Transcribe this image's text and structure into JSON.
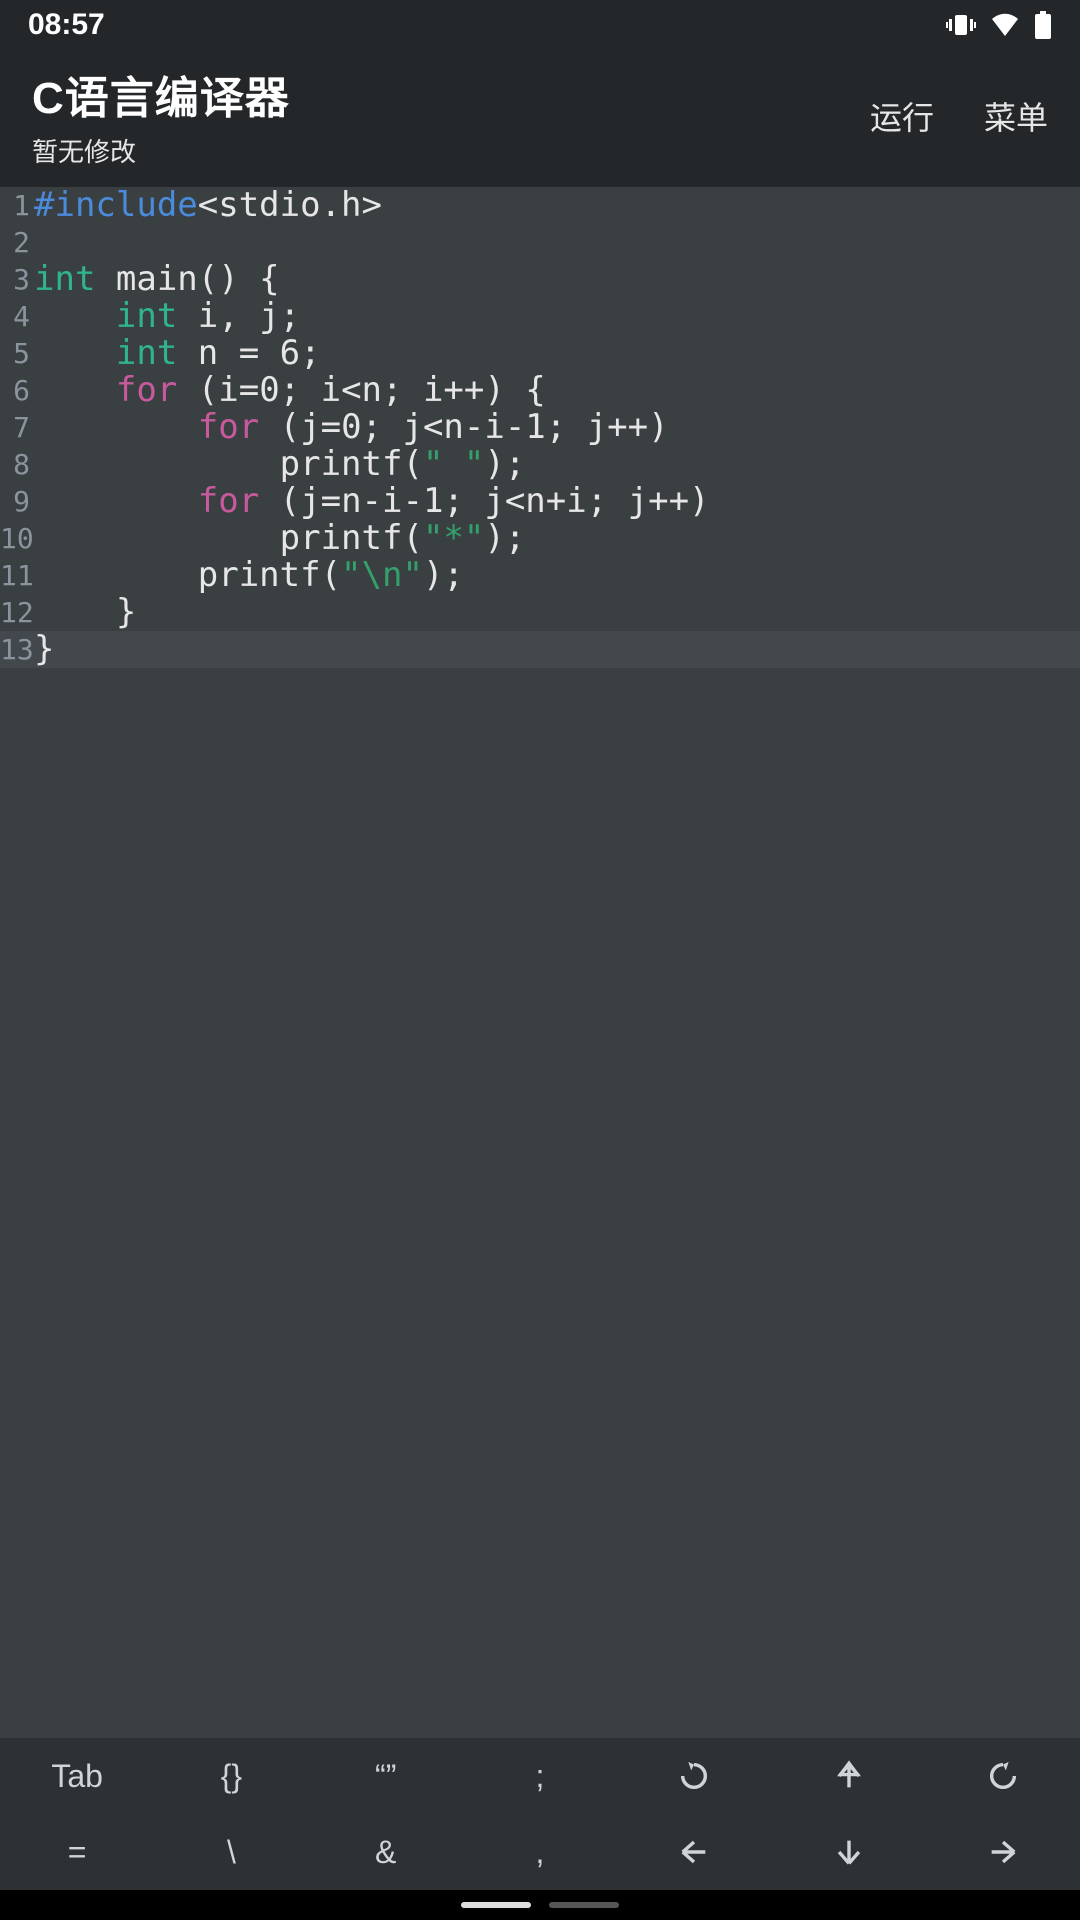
{
  "status": {
    "time": "08:57"
  },
  "header": {
    "title": "C语言编译器",
    "subtitle": "暂无修改",
    "run_label": "运行",
    "menu_label": "菜单"
  },
  "code": {
    "current_line_index": 12,
    "lines": [
      {
        "n": "1",
        "tokens": [
          {
            "c": "pre",
            "t": "#include"
          },
          {
            "c": "plain",
            "t": "<stdio.h>"
          }
        ]
      },
      {
        "n": "2",
        "tokens": [
          {
            "c": "plain",
            "t": ""
          }
        ]
      },
      {
        "n": "3",
        "tokens": [
          {
            "c": "kw",
            "t": "int"
          },
          {
            "c": "plain",
            "t": " main() {"
          }
        ]
      },
      {
        "n": "4",
        "tokens": [
          {
            "c": "plain",
            "t": "    "
          },
          {
            "c": "kw",
            "t": "int"
          },
          {
            "c": "plain",
            "t": " i, j;"
          }
        ]
      },
      {
        "n": "5",
        "tokens": [
          {
            "c": "plain",
            "t": "    "
          },
          {
            "c": "kw",
            "t": "int"
          },
          {
            "c": "plain",
            "t": " n = 6;"
          }
        ]
      },
      {
        "n": "6",
        "tokens": [
          {
            "c": "plain",
            "t": "    "
          },
          {
            "c": "ctrl",
            "t": "for"
          },
          {
            "c": "plain",
            "t": " (i=0; i<n; i++) {"
          }
        ]
      },
      {
        "n": "7",
        "tokens": [
          {
            "c": "plain",
            "t": "        "
          },
          {
            "c": "ctrl",
            "t": "for"
          },
          {
            "c": "plain",
            "t": " (j=0; j<n-i-1; j++)"
          }
        ]
      },
      {
        "n": "8",
        "tokens": [
          {
            "c": "plain",
            "t": "            printf("
          },
          {
            "c": "str",
            "t": "\" \""
          },
          {
            "c": "plain",
            "t": ");"
          }
        ]
      },
      {
        "n": "9",
        "tokens": [
          {
            "c": "plain",
            "t": "        "
          },
          {
            "c": "ctrl",
            "t": "for"
          },
          {
            "c": "plain",
            "t": " (j=n-i-1; j<n+i; j++)"
          }
        ]
      },
      {
        "n": "10",
        "tokens": [
          {
            "c": "plain",
            "t": "            printf("
          },
          {
            "c": "str",
            "t": "\"*\""
          },
          {
            "c": "plain",
            "t": ");"
          }
        ]
      },
      {
        "n": "11",
        "tokens": [
          {
            "c": "plain",
            "t": "        printf("
          },
          {
            "c": "str",
            "t": "\"\\n\""
          },
          {
            "c": "plain",
            "t": ");"
          }
        ]
      },
      {
        "n": "12",
        "tokens": [
          {
            "c": "plain",
            "t": "    }"
          }
        ]
      },
      {
        "n": "13",
        "tokens": [
          {
            "c": "plain",
            "t": "}"
          }
        ]
      }
    ]
  },
  "toolbar": {
    "row1": [
      {
        "kind": "text",
        "label": "Tab",
        "name": "key-tab"
      },
      {
        "kind": "text",
        "label": "{}",
        "name": "key-braces"
      },
      {
        "kind": "text",
        "label": "“”",
        "name": "key-quotes"
      },
      {
        "kind": "text",
        "label": ";",
        "name": "key-semicolon"
      },
      {
        "kind": "icon",
        "icon": "undo",
        "name": "key-undo"
      },
      {
        "kind": "icon",
        "icon": "arrow-up",
        "name": "key-arrow-up"
      },
      {
        "kind": "icon",
        "icon": "redo",
        "name": "key-redo"
      }
    ],
    "row2": [
      {
        "kind": "text",
        "label": "=",
        "name": "key-equals"
      },
      {
        "kind": "text",
        "label": "\\",
        "name": "key-backslash"
      },
      {
        "kind": "text",
        "label": "&",
        "name": "key-ampersand"
      },
      {
        "kind": "text",
        "label": ",",
        "name": "key-comma"
      },
      {
        "kind": "icon",
        "icon": "arrow-left",
        "name": "key-arrow-left"
      },
      {
        "kind": "icon",
        "icon": "arrow-down",
        "name": "key-arrow-down"
      },
      {
        "kind": "icon",
        "icon": "arrow-right",
        "name": "key-arrow-right"
      }
    ]
  }
}
